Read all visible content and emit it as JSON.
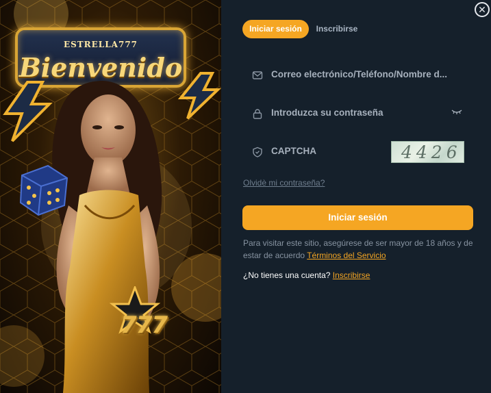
{
  "promo": {
    "brand": "ESTRELLA777",
    "welcome": "Bienvenido",
    "badge_number": "777"
  },
  "tabs": {
    "login": "Iniciar sesión",
    "register": "Inscribirse"
  },
  "form": {
    "email_placeholder": "Correo electrónico/Teléfono/Nombre d...",
    "password_placeholder": "Introduzca su contraseña",
    "captcha_placeholder": "CAPTCHA",
    "captcha_code": "4426",
    "forgot_password": "Olvidè mi contraseña?",
    "submit": "Iniciar sesión"
  },
  "notice": {
    "text": "Para visitar este sitio, asegúrese de ser mayor de 18 años y de estar de acuerdo",
    "terms_link": "Términos del Servicio"
  },
  "signup": {
    "question": "¿No tienes una cuenta?",
    "link": "Inscribirse"
  },
  "icons": {
    "close": "close-icon",
    "email": "mail-icon",
    "password": "lock-icon",
    "captcha": "shield-icon",
    "toggle_password": "eye-closed-icon"
  },
  "colors": {
    "accent": "#f5a623",
    "panel_bg": "#15202b",
    "muted_text": "#a7b1bd"
  }
}
